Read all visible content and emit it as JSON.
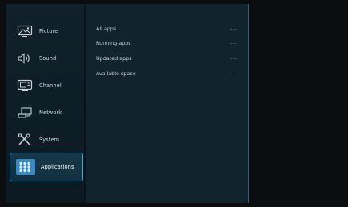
{
  "menu": {
    "items": [
      {
        "label": "Picture",
        "icon": "picture-icon"
      },
      {
        "label": "Sound",
        "icon": "speaker-icon"
      },
      {
        "label": "Channel",
        "icon": "tv-channel-icon"
      },
      {
        "label": "Network",
        "icon": "network-icon"
      },
      {
        "label": "System",
        "icon": "tools-icon"
      },
      {
        "label": "Applications",
        "icon": "applications-icon"
      }
    ],
    "selected": "Applications"
  },
  "panel": {
    "rows": [
      {
        "label": "All apps",
        "value": "---"
      },
      {
        "label": "Running apps",
        "value": "---"
      },
      {
        "label": "Updated apps",
        "value": "---"
      },
      {
        "label": "Available space",
        "value": "---"
      }
    ]
  },
  "colors": {
    "accent": "#3ea7d8",
    "sidebar_bg": "#10212b",
    "panel_bg": "#11232d",
    "background": "#0c0d0f"
  }
}
